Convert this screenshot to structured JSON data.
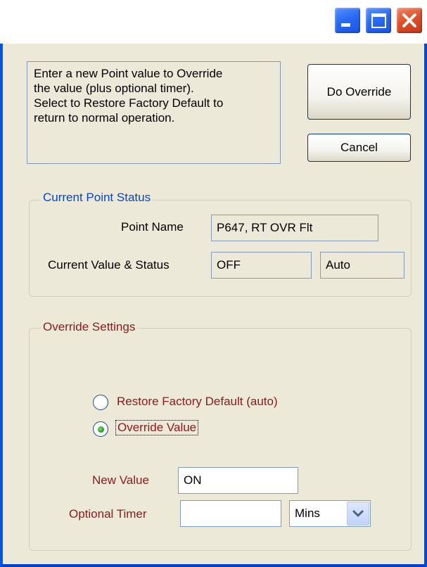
{
  "titlebar": {
    "minimize_icon": "minimize-icon",
    "maximize_icon": "maximize-icon",
    "close_icon": "close-icon"
  },
  "instructions": {
    "line1": "Enter a new Point value to Override",
    "line2": "the value (plus optional timer).",
    "line3": "Select to Restore Factory Default to",
    "line4": "return to normal operation."
  },
  "buttons": {
    "override_label": "Do Override",
    "cancel_label": "Cancel"
  },
  "status": {
    "title": "Current Point Status",
    "point_name_label": "Point Name",
    "point_name_value": "P647, RT OVR Flt",
    "current_label": "Current Value & Status",
    "current_value": "OFF",
    "current_status": "Auto"
  },
  "override": {
    "title": "Override Settings",
    "restore_label": "Restore Factory Default (auto)",
    "restore_selected": false,
    "override_label": "Override Value",
    "override_selected": true,
    "new_value_label": "New Value",
    "new_value": "ON",
    "timer_label": "Optional Timer",
    "timer_value": "",
    "timer_unit": "Mins"
  },
  "colors": {
    "window_bg": "#ece9d8",
    "titlebar_blue": "#0055e5",
    "status_title": "#0046d5",
    "override_text": "#8b1a1a",
    "close_red": "#e0522a"
  }
}
